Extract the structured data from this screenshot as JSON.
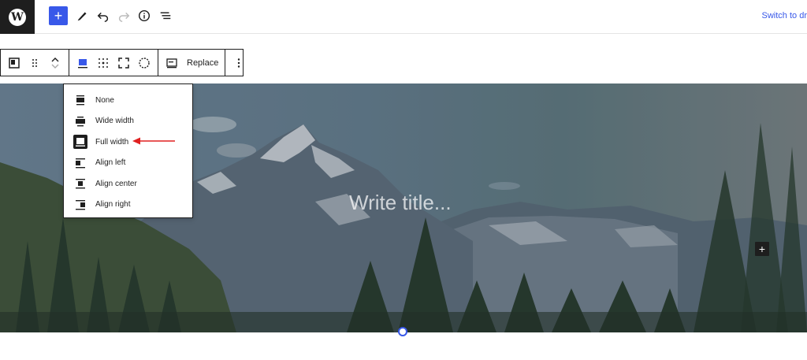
{
  "topbar": {
    "switch_label": "Switch to dr",
    "add_label": "+",
    "icons": [
      "wordpress-logo",
      "plus-icon",
      "pen-icon",
      "undo-icon",
      "redo-icon",
      "info-icon",
      "list-view-icon"
    ]
  },
  "block_toolbar": {
    "replace_label": "Replace",
    "icons": [
      "cover-block-icon",
      "drag-handle-icon",
      "move-up-down-icon",
      "align-full-icon",
      "grid-icon",
      "fullscreen-icon",
      "circle-dashed-icon",
      "replace-image-icon",
      "more-options-icon"
    ]
  },
  "align_menu": {
    "items": [
      {
        "label": "None",
        "active": false
      },
      {
        "label": "Wide width",
        "active": false
      },
      {
        "label": "Full width",
        "active": true
      },
      {
        "label": "Align left",
        "active": false
      },
      {
        "label": "Align center",
        "active": false
      },
      {
        "label": "Align right",
        "active": false
      }
    ]
  },
  "cover": {
    "title_placeholder": "Write title...",
    "add_label": "+"
  },
  "colors": {
    "accent": "#3858e9",
    "dark": "#1e1e1e",
    "annotation_arrow": "#e02020"
  }
}
